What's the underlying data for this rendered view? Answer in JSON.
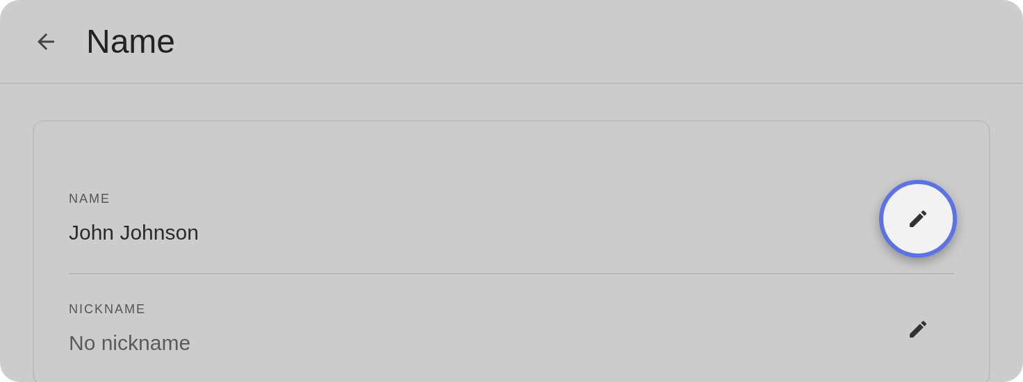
{
  "header": {
    "title": "Name"
  },
  "fields": [
    {
      "label": "NAME",
      "value": "John Johnson",
      "empty": false,
      "highlighted": true
    },
    {
      "label": "NICKNAME",
      "value": "No nickname",
      "empty": true,
      "highlighted": false
    }
  ]
}
